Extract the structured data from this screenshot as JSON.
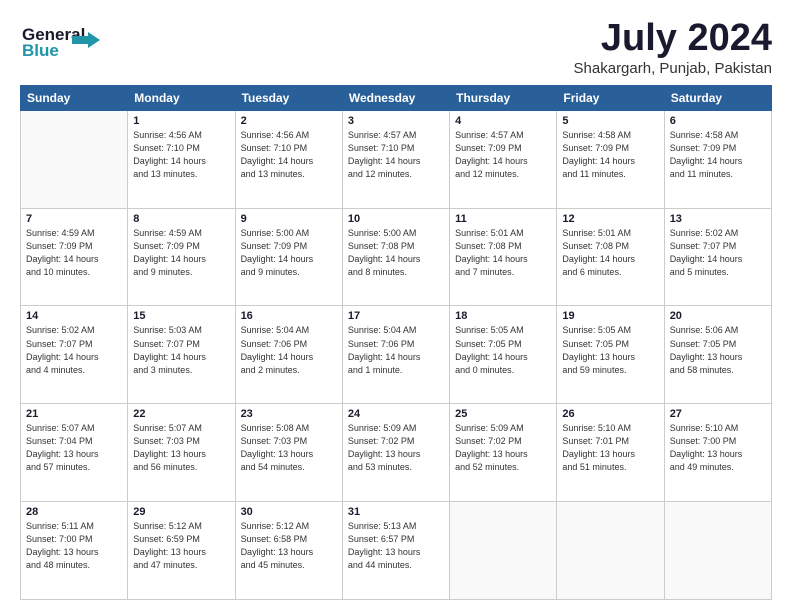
{
  "logo": {
    "line1": "General",
    "line2": "Blue"
  },
  "title": "July 2024",
  "location": "Shakargarh, Punjab, Pakistan",
  "days_of_week": [
    "Sunday",
    "Monday",
    "Tuesday",
    "Wednesday",
    "Thursday",
    "Friday",
    "Saturday"
  ],
  "weeks": [
    [
      {
        "day": "",
        "info": ""
      },
      {
        "day": "1",
        "info": "Sunrise: 4:56 AM\nSunset: 7:10 PM\nDaylight: 14 hours\nand 13 minutes."
      },
      {
        "day": "2",
        "info": "Sunrise: 4:56 AM\nSunset: 7:10 PM\nDaylight: 14 hours\nand 13 minutes."
      },
      {
        "day": "3",
        "info": "Sunrise: 4:57 AM\nSunset: 7:10 PM\nDaylight: 14 hours\nand 12 minutes."
      },
      {
        "day": "4",
        "info": "Sunrise: 4:57 AM\nSunset: 7:09 PM\nDaylight: 14 hours\nand 12 minutes."
      },
      {
        "day": "5",
        "info": "Sunrise: 4:58 AM\nSunset: 7:09 PM\nDaylight: 14 hours\nand 11 minutes."
      },
      {
        "day": "6",
        "info": "Sunrise: 4:58 AM\nSunset: 7:09 PM\nDaylight: 14 hours\nand 11 minutes."
      }
    ],
    [
      {
        "day": "7",
        "info": "Sunrise: 4:59 AM\nSunset: 7:09 PM\nDaylight: 14 hours\nand 10 minutes."
      },
      {
        "day": "8",
        "info": "Sunrise: 4:59 AM\nSunset: 7:09 PM\nDaylight: 14 hours\nand 9 minutes."
      },
      {
        "day": "9",
        "info": "Sunrise: 5:00 AM\nSunset: 7:09 PM\nDaylight: 14 hours\nand 9 minutes."
      },
      {
        "day": "10",
        "info": "Sunrise: 5:00 AM\nSunset: 7:08 PM\nDaylight: 14 hours\nand 8 minutes."
      },
      {
        "day": "11",
        "info": "Sunrise: 5:01 AM\nSunset: 7:08 PM\nDaylight: 14 hours\nand 7 minutes."
      },
      {
        "day": "12",
        "info": "Sunrise: 5:01 AM\nSunset: 7:08 PM\nDaylight: 14 hours\nand 6 minutes."
      },
      {
        "day": "13",
        "info": "Sunrise: 5:02 AM\nSunset: 7:07 PM\nDaylight: 14 hours\nand 5 minutes."
      }
    ],
    [
      {
        "day": "14",
        "info": "Sunrise: 5:02 AM\nSunset: 7:07 PM\nDaylight: 14 hours\nand 4 minutes."
      },
      {
        "day": "15",
        "info": "Sunrise: 5:03 AM\nSunset: 7:07 PM\nDaylight: 14 hours\nand 3 minutes."
      },
      {
        "day": "16",
        "info": "Sunrise: 5:04 AM\nSunset: 7:06 PM\nDaylight: 14 hours\nand 2 minutes."
      },
      {
        "day": "17",
        "info": "Sunrise: 5:04 AM\nSunset: 7:06 PM\nDaylight: 14 hours\nand 1 minute."
      },
      {
        "day": "18",
        "info": "Sunrise: 5:05 AM\nSunset: 7:05 PM\nDaylight: 14 hours\nand 0 minutes."
      },
      {
        "day": "19",
        "info": "Sunrise: 5:05 AM\nSunset: 7:05 PM\nDaylight: 13 hours\nand 59 minutes."
      },
      {
        "day": "20",
        "info": "Sunrise: 5:06 AM\nSunset: 7:05 PM\nDaylight: 13 hours\nand 58 minutes."
      }
    ],
    [
      {
        "day": "21",
        "info": "Sunrise: 5:07 AM\nSunset: 7:04 PM\nDaylight: 13 hours\nand 57 minutes."
      },
      {
        "day": "22",
        "info": "Sunrise: 5:07 AM\nSunset: 7:03 PM\nDaylight: 13 hours\nand 56 minutes."
      },
      {
        "day": "23",
        "info": "Sunrise: 5:08 AM\nSunset: 7:03 PM\nDaylight: 13 hours\nand 54 minutes."
      },
      {
        "day": "24",
        "info": "Sunrise: 5:09 AM\nSunset: 7:02 PM\nDaylight: 13 hours\nand 53 minutes."
      },
      {
        "day": "25",
        "info": "Sunrise: 5:09 AM\nSunset: 7:02 PM\nDaylight: 13 hours\nand 52 minutes."
      },
      {
        "day": "26",
        "info": "Sunrise: 5:10 AM\nSunset: 7:01 PM\nDaylight: 13 hours\nand 51 minutes."
      },
      {
        "day": "27",
        "info": "Sunrise: 5:10 AM\nSunset: 7:00 PM\nDaylight: 13 hours\nand 49 minutes."
      }
    ],
    [
      {
        "day": "28",
        "info": "Sunrise: 5:11 AM\nSunset: 7:00 PM\nDaylight: 13 hours\nand 48 minutes."
      },
      {
        "day": "29",
        "info": "Sunrise: 5:12 AM\nSunset: 6:59 PM\nDaylight: 13 hours\nand 47 minutes."
      },
      {
        "day": "30",
        "info": "Sunrise: 5:12 AM\nSunset: 6:58 PM\nDaylight: 13 hours\nand 45 minutes."
      },
      {
        "day": "31",
        "info": "Sunrise: 5:13 AM\nSunset: 6:57 PM\nDaylight: 13 hours\nand 44 minutes."
      },
      {
        "day": "",
        "info": ""
      },
      {
        "day": "",
        "info": ""
      },
      {
        "day": "",
        "info": ""
      }
    ]
  ]
}
